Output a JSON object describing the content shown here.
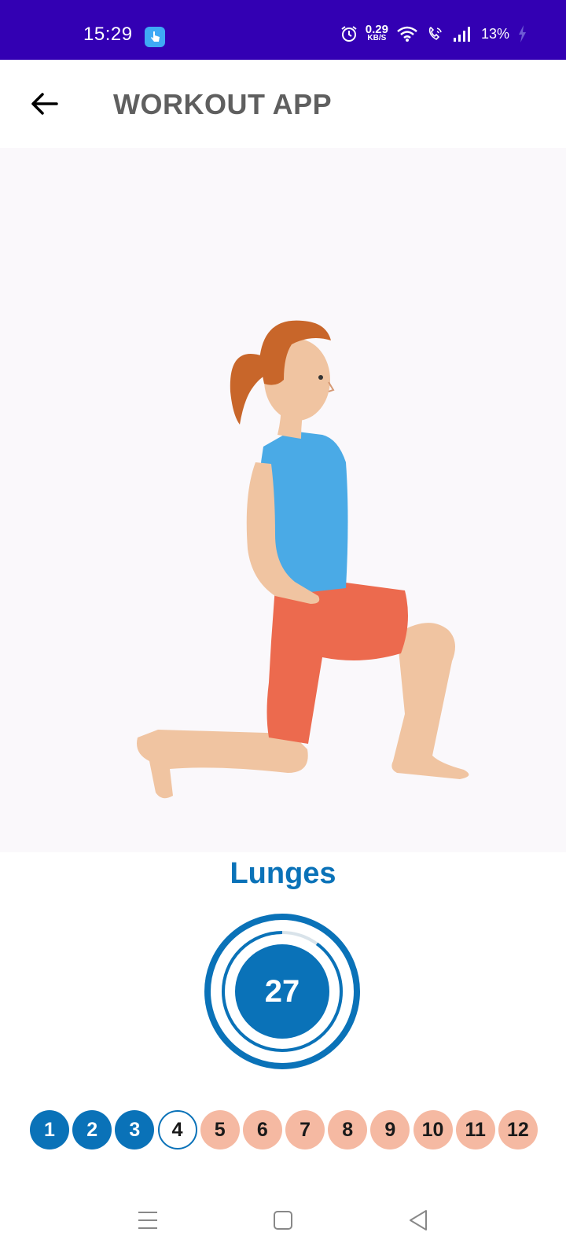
{
  "status_bar": {
    "time": "15:29",
    "net_speed_value": "0.29",
    "net_speed_unit": "KB/S",
    "battery": "13%",
    "icons": [
      "alarm-icon",
      "wifi-icon",
      "call-icon",
      "signal-icon",
      "battery-charging-icon"
    ],
    "background_color": "#3300b3"
  },
  "app_bar": {
    "title": "WORKOUT APP",
    "back_icon": "arrow-left-icon"
  },
  "exercise": {
    "name": "Lunges",
    "image": "woman-lunge-illustration",
    "timer_value": "27",
    "timer_remaining_fraction": 0.9
  },
  "progress": {
    "steps": [
      {
        "label": "1",
        "state": "done"
      },
      {
        "label": "2",
        "state": "done"
      },
      {
        "label": "3",
        "state": "done"
      },
      {
        "label": "4",
        "state": "current"
      },
      {
        "label": "5",
        "state": "pending"
      },
      {
        "label": "6",
        "state": "pending"
      },
      {
        "label": "7",
        "state": "pending"
      },
      {
        "label": "8",
        "state": "pending"
      },
      {
        "label": "9",
        "state": "pending"
      },
      {
        "label": "10",
        "state": "pending"
      },
      {
        "label": "11",
        "state": "pending"
      },
      {
        "label": "12",
        "state": "pending"
      }
    ]
  },
  "nav_bar": {
    "buttons": [
      "menu-icon",
      "home-icon",
      "back-triangle-icon"
    ]
  },
  "colors": {
    "accent": "#0a72b8",
    "pending": "#f5b9a2",
    "title_gray": "#5f5f5f"
  }
}
